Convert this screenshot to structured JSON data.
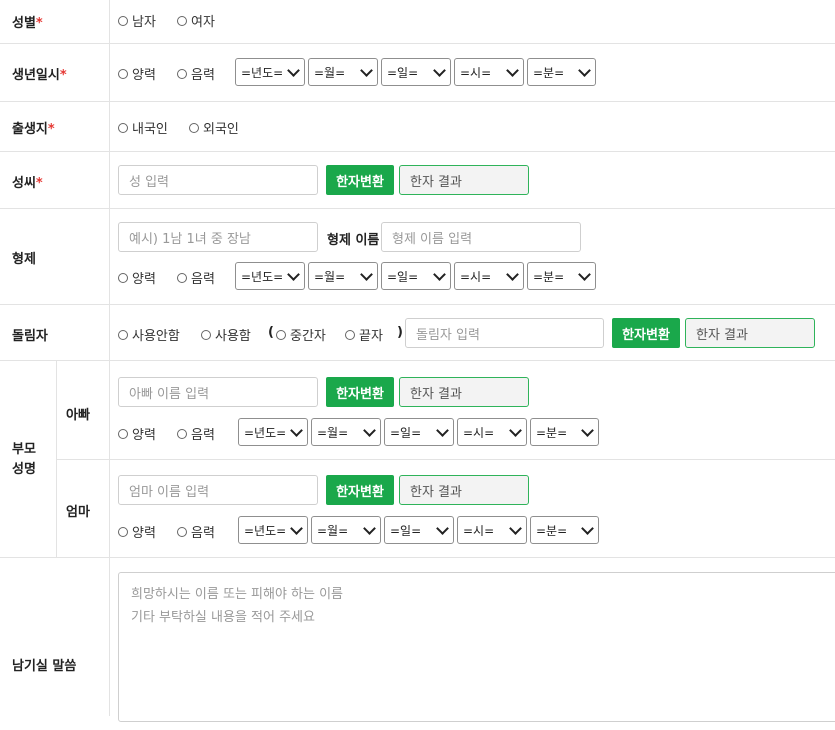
{
  "labels": {
    "gender": "성별",
    "birth": "생년일시",
    "birthplace": "출생지",
    "surname": "성씨",
    "sibling": "형제",
    "dollimja": "돌림자",
    "parents": "부모\n성명",
    "father": "아빠",
    "mother": "엄마",
    "message": "남기실 말씀",
    "required_mark": "*"
  },
  "gender": {
    "options": [
      "남자",
      "여자"
    ]
  },
  "calendar_options": [
    "양력",
    "음력"
  ],
  "birthplace": {
    "options": [
      "내국인",
      "외국인"
    ]
  },
  "date_selects": {
    "year": "=년도=",
    "month": "=월=",
    "day": "=일=",
    "hour": "=시=",
    "minute": "=분="
  },
  "surname": {
    "placeholder": "성 입력"
  },
  "hanja_button": "한자변환",
  "hanja_result": "한자 결과",
  "sibling": {
    "order_placeholder": "예시) 1남 1녀 중 장남",
    "name_label": "형제 이름",
    "name_placeholder": "형제 이름 입력"
  },
  "dollimja": {
    "not_used": "사용안함",
    "used": "사용함",
    "paren_open": "(",
    "middle": "중간자",
    "last": "끝자",
    "paren_close": ")",
    "placeholder": "돌림자 입력"
  },
  "father": {
    "placeholder": "아빠 이름 입력"
  },
  "mother": {
    "placeholder": "엄마 이름 입력"
  },
  "message": {
    "placeholder": "희망하시는 이름 또는 피해야 하는 이름\n기타 부탁하실 내용을 적어 주세요"
  }
}
